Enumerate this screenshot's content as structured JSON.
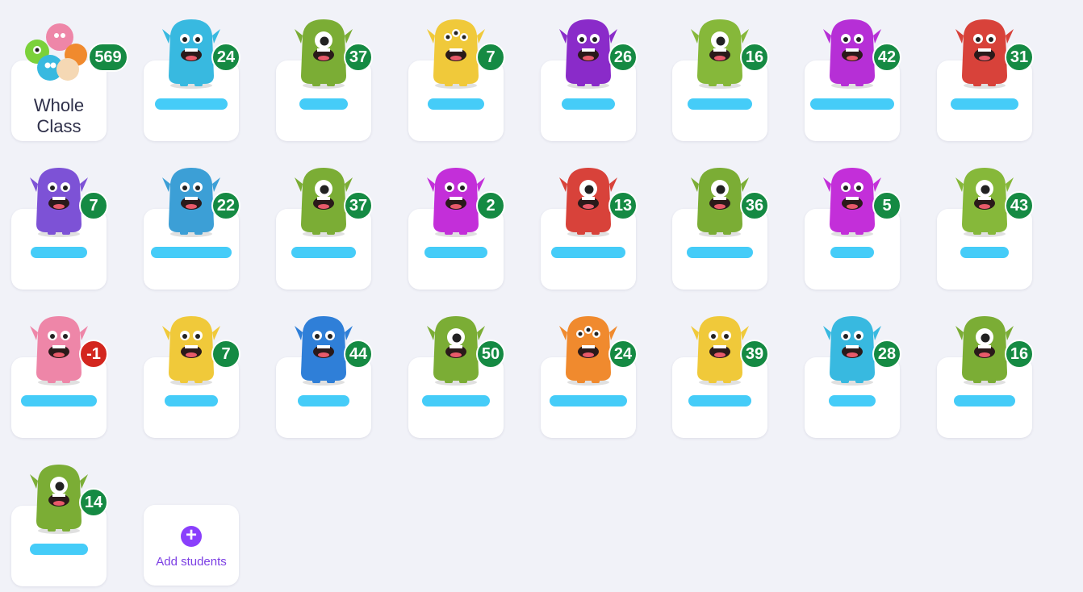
{
  "whole_class": {
    "label": "Whole Class",
    "points": "569"
  },
  "students": [
    {
      "points": "24",
      "color": "#38b9e0",
      "eye": "two",
      "badge": "#158a43"
    },
    {
      "points": "37",
      "color": "#7bad35",
      "eye": "one",
      "badge": "#158a43"
    },
    {
      "points": "7",
      "color": "#f0c93a",
      "eye": "three",
      "badge": "#158a43"
    },
    {
      "points": "26",
      "color": "#8a2bc9",
      "eye": "two",
      "badge": "#158a43"
    },
    {
      "points": "16",
      "color": "#86b83a",
      "eye": "one",
      "badge": "#158a43"
    },
    {
      "points": "42",
      "color": "#b62fd6",
      "eye": "two",
      "badge": "#158a43"
    },
    {
      "points": "31",
      "color": "#d8423a",
      "eye": "two",
      "badge": "#158a43"
    },
    {
      "points": "7",
      "color": "#7d52d6",
      "eye": "two",
      "badge": "#158a43"
    },
    {
      "points": "22",
      "color": "#3c9fd6",
      "eye": "two",
      "badge": "#158a43"
    },
    {
      "points": "37",
      "color": "#7bad35",
      "eye": "one",
      "badge": "#158a43"
    },
    {
      "points": "2",
      "color": "#c32fd9",
      "eye": "two",
      "badge": "#158a43"
    },
    {
      "points": "13",
      "color": "#d8423a",
      "eye": "one",
      "badge": "#158a43"
    },
    {
      "points": "36",
      "color": "#7bad35",
      "eye": "one",
      "badge": "#158a43"
    },
    {
      "points": "5",
      "color": "#c32fd9",
      "eye": "two",
      "badge": "#158a43"
    },
    {
      "points": "43",
      "color": "#86b83a",
      "eye": "one",
      "badge": "#158a43"
    },
    {
      "points": "-1",
      "color": "#ee86a8",
      "eye": "two",
      "badge": "#d3261e"
    },
    {
      "points": "7",
      "color": "#f0c93a",
      "eye": "two",
      "badge": "#158a43"
    },
    {
      "points": "44",
      "color": "#2f7fd8",
      "eye": "two",
      "badge": "#158a43"
    },
    {
      "points": "50",
      "color": "#7bad35",
      "eye": "one",
      "badge": "#158a43"
    },
    {
      "points": "24",
      "color": "#f08a2e",
      "eye": "three",
      "badge": "#158a43"
    },
    {
      "points": "39",
      "color": "#f0c93a",
      "eye": "two",
      "badge": "#158a43"
    },
    {
      "points": "28",
      "color": "#38b9e0",
      "eye": "two",
      "badge": "#158a43"
    },
    {
      "points": "16",
      "color": "#7bad35",
      "eye": "one",
      "badge": "#158a43"
    },
    {
      "points": "14",
      "color": "#7bad35",
      "eye": "one",
      "badge": "#158a43"
    }
  ],
  "add_students": {
    "label": "Add students",
    "icon": "plus-circle-icon",
    "color": "#8a3ffc"
  }
}
